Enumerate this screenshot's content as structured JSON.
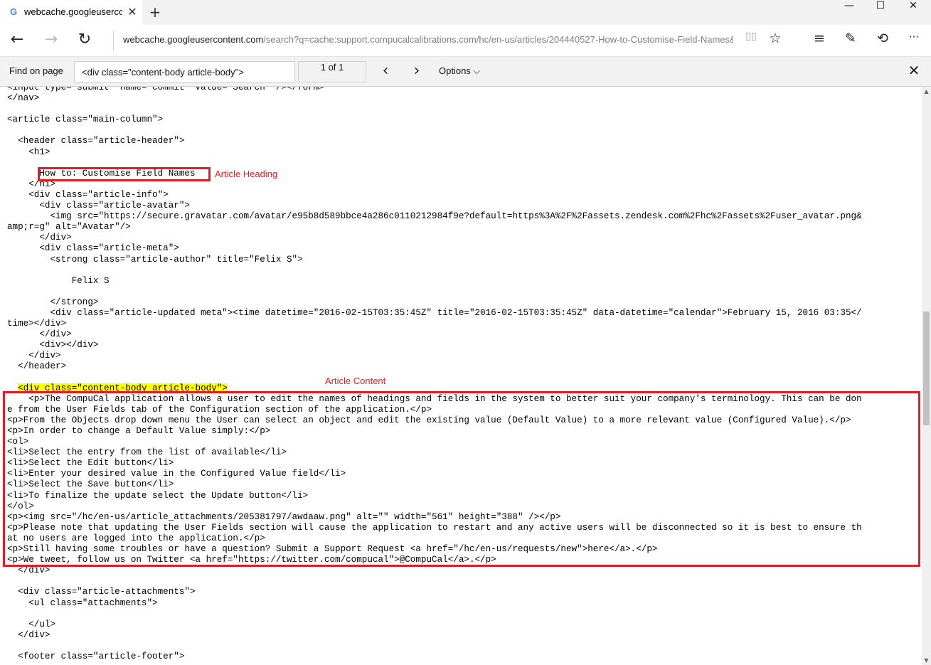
{
  "tab": {
    "favicon": "G",
    "title": "webcache.googleusercontent.com",
    "close": "✕",
    "new_tab": "+"
  },
  "window": {
    "minimize": "—",
    "maximize": "☐",
    "close": "✕"
  },
  "nav": {
    "back": "←",
    "forward": "→",
    "refresh": "↻",
    "url_host": "webcache.googleusercontent.com",
    "url_path": "/search?q=cache:support.compucalcalibrations.com/hc/en-us/articles/204440527-How-to-Customise-Field-Names&",
    "reading_view": "▯▯",
    "favorite": "☆",
    "hub": "≡",
    "web_note": "✎",
    "share": "⟲",
    "more": "···"
  },
  "find": {
    "label": "Find on page",
    "query": "<div class=\"content-body article-body\">",
    "count": "1 of 1",
    "prev": "‹",
    "next": "›",
    "options": "Options ⌵",
    "close": "✕"
  },
  "source": {
    "lines_top": [
      "<input type=\"submit\" name=\"commit\" value=\"Search\" /></form>",
      "</nav>",
      "",
      "<article class=\"main-column\">",
      "",
      "  <header class=\"article-header\">",
      "    <h1>",
      "",
      "      How to: Customise Field Names",
      "    </h1>",
      "    <div class=\"article-info\">",
      "      <div class=\"article-avatar\">",
      "        <img src=\"https://secure.gravatar.com/avatar/e95b8d589bbce4a286c0110212984f9e?default=https%3A%2F%2Fassets.zendesk.com%2Fhc%2Fassets%2Fuser_avatar.png&",
      "amp;r=g\" alt=\"Avatar\"/>",
      "      </div>",
      "      <div class=\"article-meta\">",
      "        <strong class=\"article-author\" title=\"Felix S\">",
      "",
      "            Felix S",
      "",
      "        </strong>",
      "        <div class=\"article-updated meta\"><time datetime=\"2016-02-15T03:35:45Z\" title=\"2016-02-15T03:35:45Z\" data-datetime=\"calendar\">February 15, 2016 03:35</",
      "time></div>",
      "      </div>",
      "      <div></div>",
      "    </div>",
      "  </header>",
      ""
    ],
    "highlight_line": "<div class=\"content-body article-body\">",
    "lines_body": [
      "    <p>The CompuCal application allows a user to edit the names of headings and fields in the system to better suit your company's terminology. This can be don",
      "e from the User Fields tab of the Configuration section of the application.</p>",
      "<p>From the Objects drop down menu the User can select an object and edit the existing value (Default Value) to a more relevant value (Configured Value).</p>",
      "<p>In order to change a Default Value simply:</p>",
      "<ol>",
      "<li>Select the entry from the list of available</li>",
      "<li>Select the Edit button</li>",
      "<li>Enter your desired value in the Configured Value field</li>",
      "<li>Select the Save button</li>",
      "<li>To finalize the update select the Update button</li>",
      "</ol>",
      "<p><img src=\"/hc/en-us/article_attachments/205381797/awdaaw.png\" alt=\"\" width=\"561\" height=\"388\" /></p>",
      "<p>Please note that updating the User Fields section will cause the application to restart and any active users will be disconnected so it is best to ensure th",
      "at no users are logged into the application.</p>",
      "<p>Still having some troubles or have a question? Submit a Support Request <a href=\"/hc/en-us/requests/new\">here</a>.</p>",
      "<p>We tweet, follow us on Twitter <a href=\"https://twitter.com/compucal\">@CompuCal</a>.</p>"
    ],
    "lines_bottom": [
      "  </div>",
      "",
      "  <div class=\"article-attachments\">",
      "    <ul class=\"attachments\">",
      "",
      "    </ul>",
      "  </div>",
      "",
      "  <footer class=\"article-footer\">"
    ]
  },
  "annotations": {
    "heading_label": "Article Heading",
    "content_label": "Article Content",
    "color": "#e31b23"
  }
}
